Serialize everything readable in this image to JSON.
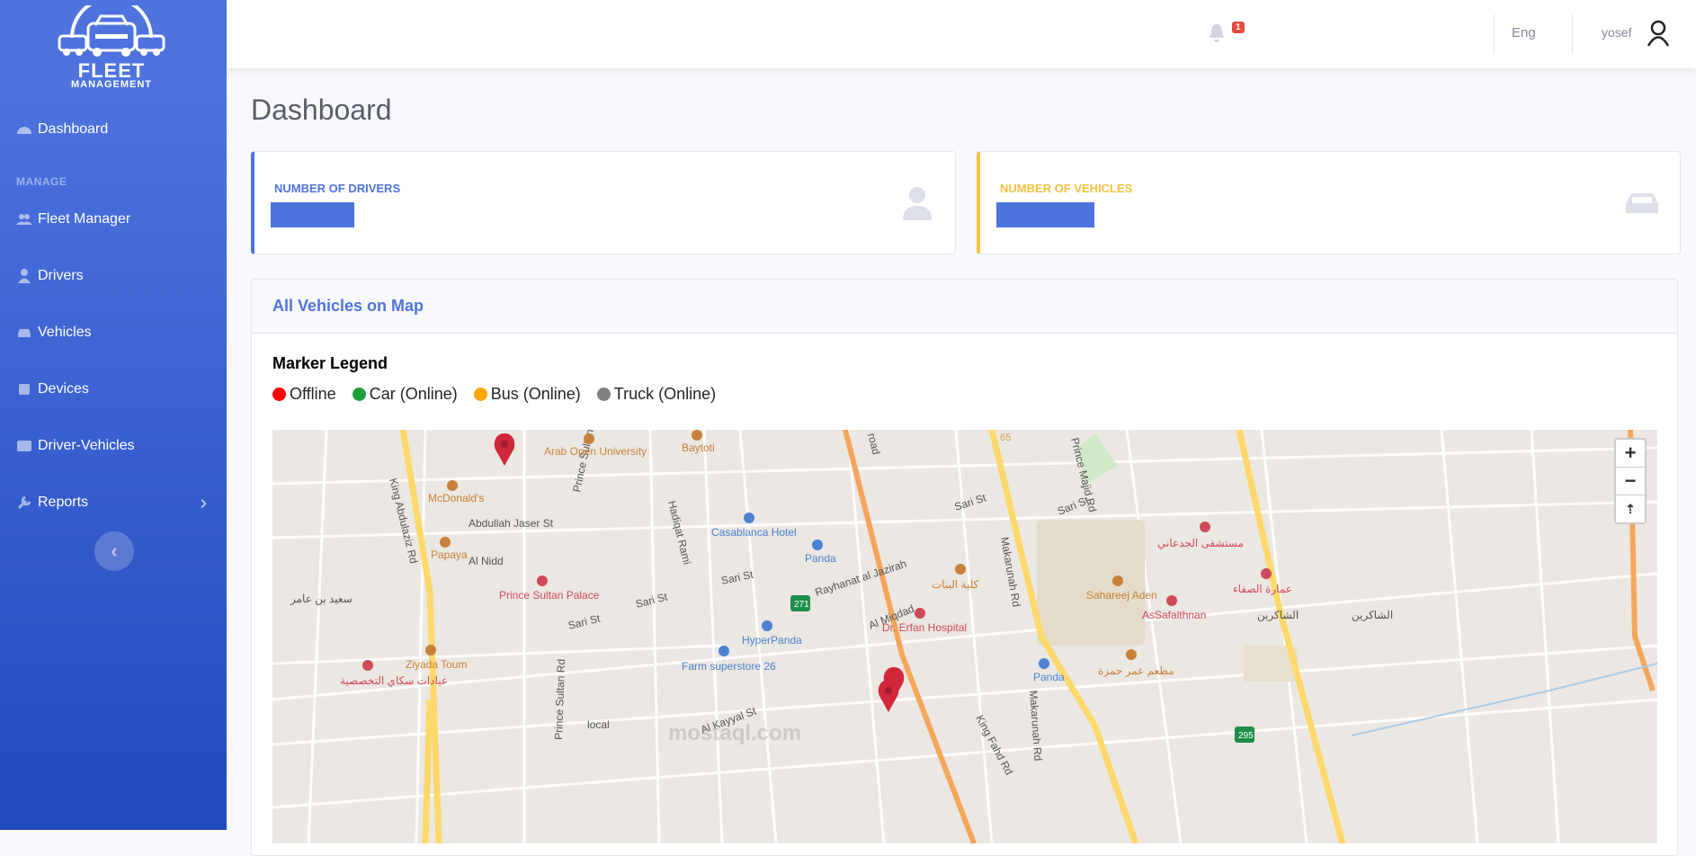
{
  "brand": {
    "line1": "FLEET",
    "line2": "MANAGEMENT"
  },
  "sidebar": {
    "heading": "MANAGE",
    "items": [
      {
        "label": "Dashboard",
        "icon": "tachometer-icon"
      },
      {
        "label": "Fleet Manager",
        "icon": "users-icon"
      },
      {
        "label": "Drivers",
        "icon": "user-icon"
      },
      {
        "label": "Vehicles",
        "icon": "car-icon"
      },
      {
        "label": "Devices",
        "icon": "chip-icon"
      },
      {
        "label": "Driver-Vehicles",
        "icon": "id-card-icon"
      },
      {
        "label": "Reports",
        "icon": "wrench-icon"
      }
    ],
    "reports_chevron": "›",
    "toggle_glyph": "‹"
  },
  "topbar": {
    "alert_count": "1",
    "language": "Eng",
    "username": "yosef"
  },
  "page": {
    "title": "Dashboard"
  },
  "stats": {
    "drivers": {
      "label": "NUMBER OF DRIVERS",
      "value": "",
      "color": "#4e73df"
    },
    "vehicles": {
      "label": "NUMBER OF VEHICLES",
      "value": "",
      "color": "#f6c23e"
    }
  },
  "map_section": {
    "title": "All Vehicles on Map",
    "legend_title": "Marker Legend",
    "legend": [
      {
        "label": "Offline",
        "color": "#ff0000"
      },
      {
        "label": "Car (Online)",
        "color": "#1e9e3a"
      },
      {
        "label": "Bus (Online)",
        "color": "#ffa500"
      },
      {
        "label": "Truck (Online)",
        "color": "#808080"
      }
    ],
    "zoom_in": "+",
    "zoom_out": "−",
    "reset": "⇡",
    "labels": {
      "arab_open": "Arab Open University",
      "baytoti": "Baytoti",
      "mcdonalds": "McDonald's",
      "abdullah_jaser": "Abdullah Jaser St",
      "papaya": "Papaya",
      "al_nidd": "Al Nidd",
      "prince_sultan_palace": "Prince Sultan Palace",
      "king_abdulaziz": "King Abdulaziz Rd",
      "prince_sultan_rd": "Prince Sultan Rd",
      "hadiqat_rami": "Hadiqat Rami",
      "casablanca": "Casablanca Hotel",
      "panda1": "Panda",
      "sari_st": "Sari St",
      "rayhanat": "Rayhanat al Jazirah",
      "al_miqdad": "Al Miqdad",
      "dr_erfan": "Dr. Erfan Hospital",
      "hyperpanda": "HyperPanda",
      "farm": "Farm superstore 26",
      "ziyada": "Ziyada Toum",
      "al_kayyal": "Al Kayyal St",
      "local": "local",
      "makarunah": "Makarunah Rd",
      "prince_majid": "Prince Majid Rd",
      "sahareej": "Sahareej Aden",
      "assafalthnan": "AsSafalthnan",
      "panda2": "Panda",
      "king_fahd": "King Fahd Rd",
      "road": "road",
      "saeed": "سعيد بن عامر",
      "jadaani": "مستشفى الجدعاني",
      "safa": "عمارة الصفاء",
      "shakreen": "الشاكرين",
      "hamza": "مطعم عمر حمزة",
      "banat": "كلية البنات",
      "clinic": "عيادات سكاي التخصصية",
      "r271": "271",
      "r295": "295",
      "r65": "65",
      "watermark": "mostaql.com"
    }
  }
}
